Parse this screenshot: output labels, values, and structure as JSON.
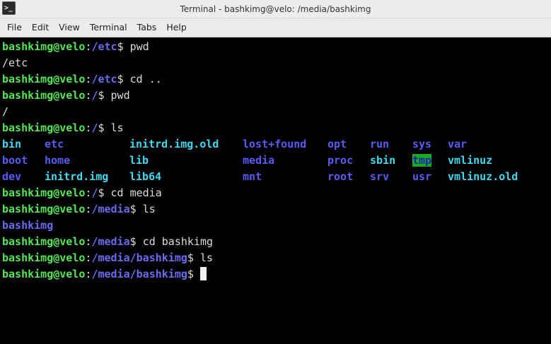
{
  "window": {
    "title": "Terminal - bashkimg@velo: /media/bashkimg",
    "icon_text": ">_"
  },
  "menu": {
    "items": [
      "File",
      "Edit",
      "View",
      "Terminal",
      "Tabs",
      "Help"
    ]
  },
  "colors": {
    "background": "#000000",
    "user_host": "#54e654",
    "path": "#6b6bf0",
    "text": "#dcdcdc",
    "dir_blue": "#5b5bf5",
    "link_cyan": "#42d9f0",
    "sticky_bg": "#1aab1a",
    "sticky_fg": "#2020c0"
  },
  "terminal": {
    "user_host": "bashkimg@velo",
    "lines": [
      {
        "path": "/etc",
        "cmd": "pwd"
      },
      {
        "output": "/etc"
      },
      {
        "path": "/etc",
        "cmd": "cd .."
      },
      {
        "path": "/",
        "cmd": "pwd"
      },
      {
        "output": "/"
      },
      {
        "path": "/",
        "cmd": "ls"
      }
    ],
    "ls_root": [
      [
        {
          "name": "bin",
          "color": "#42d9f0"
        },
        {
          "name": "etc",
          "color": "#5b5bf5"
        },
        {
          "name": "initrd.img.old",
          "color": "#42d9f0"
        },
        {
          "name": "lost+found",
          "color": "#5b5bf5"
        },
        {
          "name": "opt",
          "color": "#5b5bf5"
        },
        {
          "name": "run",
          "color": "#5b5bf5"
        },
        {
          "name": "sys",
          "color": "#5b5bf5"
        },
        {
          "name": "var",
          "color": "#5b5bf5"
        }
      ],
      [
        {
          "name": "boot",
          "color": "#5b5bf5"
        },
        {
          "name": "home",
          "color": "#5b5bf5"
        },
        {
          "name": "lib",
          "color": "#42d9f0"
        },
        {
          "name": "media",
          "color": "#5b5bf5"
        },
        {
          "name": "proc",
          "color": "#5b5bf5"
        },
        {
          "name": "sbin",
          "color": "#42d9f0"
        },
        {
          "name": "tmp",
          "color": "#2020c0",
          "bg": "#1aab1a"
        },
        {
          "name": "vmlinuz",
          "color": "#42d9f0"
        }
      ],
      [
        {
          "name": "dev",
          "color": "#5b5bf5"
        },
        {
          "name": "initrd.img",
          "color": "#42d9f0"
        },
        {
          "name": "lib64",
          "color": "#42d9f0"
        },
        {
          "name": "mnt",
          "color": "#5b5bf5"
        },
        {
          "name": "root",
          "color": "#5b5bf5"
        },
        {
          "name": "srv",
          "color": "#5b5bf5"
        },
        {
          "name": "usr",
          "color": "#5b5bf5"
        },
        {
          "name": "vmlinuz.old",
          "color": "#42d9f0"
        }
      ]
    ],
    "lines_after": [
      {
        "path": "/",
        "cmd": "cd media"
      },
      {
        "path": "/media",
        "cmd": "ls"
      },
      {
        "dir_output": "bashkimg"
      },
      {
        "path": "/media",
        "cmd": "cd bashkimg"
      },
      {
        "path": "/media/bashkimg",
        "cmd": "ls"
      },
      {
        "path": "/media/bashkimg",
        "cmd": "",
        "cursor": true
      }
    ]
  }
}
